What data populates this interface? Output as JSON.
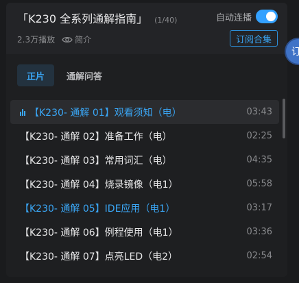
{
  "header": {
    "title": "「K230 全系列通解指南」",
    "count": "(1/40)",
    "autoplay_label": "自动连播",
    "autoplay_on": true,
    "plays": "2.3万播放",
    "intro_label": "简介",
    "subscribe_label": "订阅合集"
  },
  "tabs": [
    {
      "label": "正片",
      "active": true
    },
    {
      "label": "通解问答",
      "active": false
    }
  ],
  "episodes": [
    {
      "title": "【K230- 通解 01】观看须知（电）",
      "duration": "03:43",
      "state": "playing"
    },
    {
      "title": "【K230- 通解 02】准备工作（电）",
      "duration": "02:25",
      "state": "normal"
    },
    {
      "title": "【K230- 通解 03】常用词汇（电）",
      "duration": "04:35",
      "state": "normal"
    },
    {
      "title": "【K230- 通解 04】烧录镜像（电1）",
      "duration": "05:58",
      "state": "normal"
    },
    {
      "title": "【K230- 通解 05】IDE应用（电1）",
      "duration": "03:17",
      "state": "visited"
    },
    {
      "title": "【K230- 通解 06】例程使用（电1）",
      "duration": "03:36",
      "state": "normal"
    },
    {
      "title": "【K230- 通解 07】点亮LED（电2）",
      "duration": "02:54",
      "state": "normal"
    }
  ],
  "side_button_glyph": "订",
  "colors": {
    "accent": "#3aa6f5",
    "panel": "#232427",
    "list_bg": "#1e1f21"
  }
}
